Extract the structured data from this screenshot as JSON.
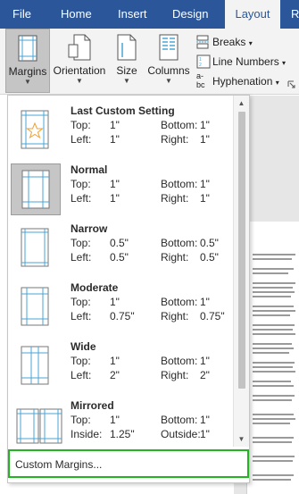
{
  "ribbon_tabs": {
    "file": "File",
    "home": "Home",
    "insert": "Insert",
    "design": "Design",
    "layout": "Layout",
    "references_partial": "R"
  },
  "ribbon": {
    "margins": "Margins",
    "orientation": "Orientation",
    "size": "Size",
    "columns": "Columns",
    "breaks": "Breaks",
    "line_numbers": "Line Numbers",
    "hyphenation": "Hyphenation",
    "hyphenation_icon_text": "a-\nbc"
  },
  "margins_menu": {
    "presets": [
      {
        "name": "Last Custom Setting",
        "top_label": "Top:",
        "top": "1\"",
        "bottom_label": "Bottom:",
        "bottom": "1\"",
        "left_label": "Left:",
        "left": "1\"",
        "right_label": "Right:",
        "right": "1\""
      },
      {
        "name": "Normal",
        "top_label": "Top:",
        "top": "1\"",
        "bottom_label": "Bottom:",
        "bottom": "1\"",
        "left_label": "Left:",
        "left": "1\"",
        "right_label": "Right:",
        "right": "1\""
      },
      {
        "name": "Narrow",
        "top_label": "Top:",
        "top": "0.5\"",
        "bottom_label": "Bottom:",
        "bottom": "0.5\"",
        "left_label": "Left:",
        "left": "0.5\"",
        "right_label": "Right:",
        "right": "0.5\""
      },
      {
        "name": "Moderate",
        "top_label": "Top:",
        "top": "1\"",
        "bottom_label": "Bottom:",
        "bottom": "1\"",
        "left_label": "Left:",
        "left": "0.75\"",
        "right_label": "Right:",
        "right": "0.75\""
      },
      {
        "name": "Wide",
        "top_label": "Top:",
        "top": "1\"",
        "bottom_label": "Bottom:",
        "bottom": "1\"",
        "left_label": "Left:",
        "left": "2\"",
        "right_label": "Right:",
        "right": "2\""
      },
      {
        "name": "Mirrored",
        "top_label": "Top:",
        "top": "1\"",
        "bottom_label": "Bottom:",
        "bottom": "1\"",
        "left_label": "Inside:",
        "left": "1.25\"",
        "right_label": "Outside:",
        "right": "1\""
      }
    ],
    "custom_margins": "Custom Margins...",
    "selected": "Normal"
  },
  "colors": {
    "brand": "#2b579a",
    "highlight_box": "#22b422",
    "margin_guide": "#4aa6d6",
    "star": "#f0a030"
  }
}
